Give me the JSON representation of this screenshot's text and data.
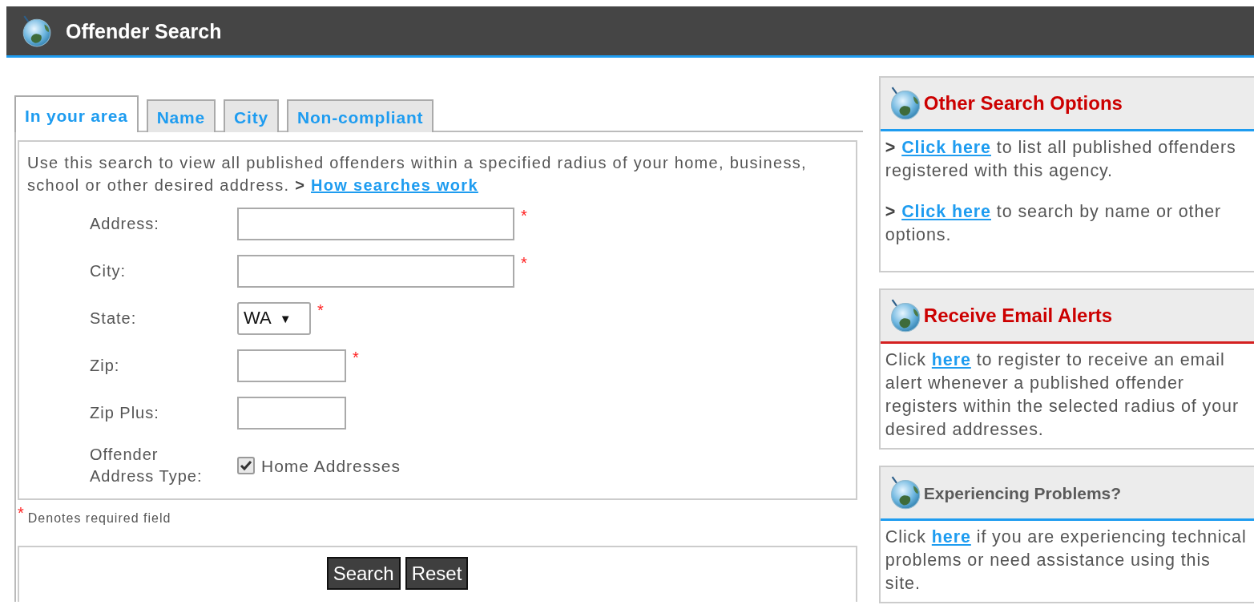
{
  "header": {
    "title": "Offender Search"
  },
  "tabs": [
    {
      "label": "In your area",
      "selected": true
    },
    {
      "label": "Name",
      "selected": false
    },
    {
      "label": "City",
      "selected": false
    },
    {
      "label": "Non-compliant",
      "selected": false
    }
  ],
  "intro": {
    "before": "Use this search to view all published offenders within a specified radius of your home, business, school or other desired address. ",
    "arrow": ">",
    "link": "How searches work"
  },
  "fields": [
    {
      "label": "Address:",
      "kind": "text",
      "wide": true,
      "required": true,
      "required_mark": "*"
    },
    {
      "label": "City:",
      "kind": "text",
      "wide": true,
      "required": true,
      "required_mark": "*"
    },
    {
      "label": "State:",
      "kind": "select",
      "value": "WA",
      "caret": "▼",
      "required": true,
      "required_mark": "*"
    },
    {
      "label": "Zip:",
      "kind": "text",
      "wide": false,
      "required": true,
      "required_mark": "*"
    },
    {
      "label": "Zip Plus:",
      "kind": "text",
      "wide": false,
      "required": false
    },
    {
      "label": "Offender Address Type:",
      "kind": "checkbox",
      "option": "Home Addresses",
      "checked": true
    }
  ],
  "required_note": {
    "mark": "*",
    "text": "Denotes required field"
  },
  "buttons": [
    "Search",
    "Reset"
  ],
  "sidebar": [
    {
      "title": "Other Search Options",
      "color": "#cc0000",
      "kind": "info",
      "paragraphs": [
        {
          "arrow": ">",
          "link": "Click here",
          "after": " to list all published offenders registered with this agency."
        },
        {
          "arrow": ">",
          "link": "Click here",
          "after": " to search by name or other options."
        }
      ]
    },
    {
      "title": "Receive Email Alerts",
      "color": "#cc0000",
      "kind": "alert",
      "paragraphs": [
        {
          "before": "Click ",
          "link": "here",
          "after": " to register to receive an email alert whenever a published offender registers within the selected radius of your desired addresses."
        }
      ]
    },
    {
      "title": "Experiencing Problems?",
      "color": "#5a5a5a",
      "kind": "info",
      "paragraphs": [
        {
          "before": "Click ",
          "link": "here",
          "after": " if you are experiencing technical problems or need assistance using this site."
        }
      ]
    }
  ]
}
